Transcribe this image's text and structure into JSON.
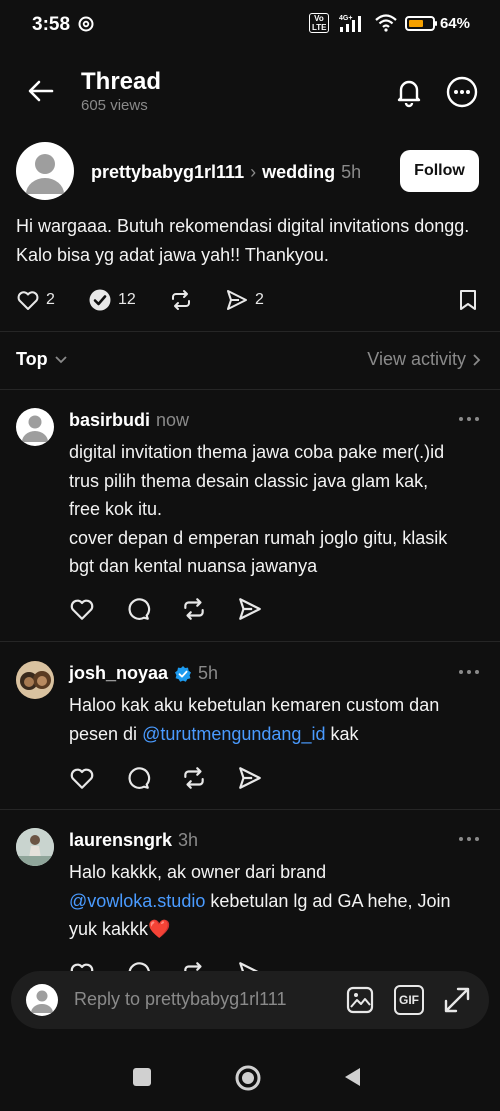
{
  "status": {
    "time": "3:58",
    "volte": "Vo LTE",
    "network": "4G+",
    "battery_pct": "64%",
    "battery_level": 0.64
  },
  "header": {
    "title": "Thread",
    "views": "605 views"
  },
  "post": {
    "username": "prettybabyg1rl111",
    "topic": "wedding",
    "time": "5h",
    "follow_label": "Follow",
    "text": "Hi wargaaa. Butuh rekomendasi digital invitations dongg. Kalo bisa yg adat jawa yah!! Thankyou.",
    "likes": "2",
    "replies": "12",
    "shares": "2"
  },
  "sort": {
    "label": "Top",
    "view_activity": "View activity"
  },
  "replies": [
    {
      "username": "basirbudi",
      "time": "now",
      "text_lines": [
        "digital invitation thema jawa coba pake mer(.)id",
        "trus pilih thema desain classic java glam kak,",
        "free kok itu.",
        "cover depan d emperan rumah joglo gitu, klasik",
        "bgt dan kental nuansa jawanya"
      ]
    },
    {
      "username": "josh_noyaa",
      "time": "5h",
      "verified": true,
      "text_before": "Haloo kak aku kebetulan kemaren custom dan pesen di ",
      "mention": "@turutmengundang_id",
      "text_after": " kak"
    },
    {
      "username": "laurensngrk",
      "time": "3h",
      "text_line1": "Halo kakkk, ak owner dari brand",
      "mention": "@vowloka.studio",
      "text_after": " kebetulan lg ad GA hehe, Join yuk kakkk❤️"
    }
  ],
  "reply_bar": {
    "placeholder": "Reply to prettybabyg1rl111",
    "gif_label": "GIF"
  },
  "icons": {
    "back": "arrow-left-icon",
    "notify": "bell-icon",
    "more": "more-circle-icon",
    "like": "heart-icon",
    "reply": "comment-icon",
    "repost": "repost-icon",
    "share": "send-icon",
    "bookmark": "bookmark-icon"
  }
}
